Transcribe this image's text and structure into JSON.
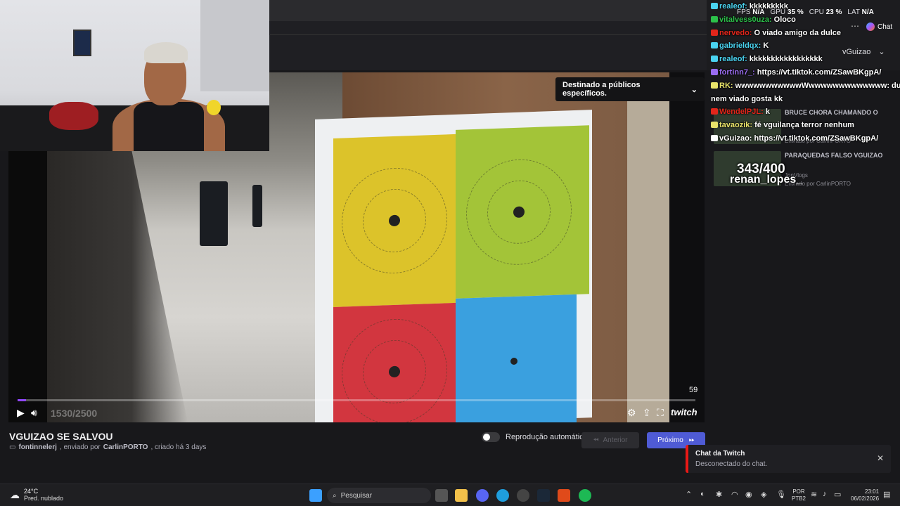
{
  "video": {
    "audience_label": "Destinado a públicos específicos.",
    "counter": "59",
    "timecode": "1530/2500",
    "brand": "twitch",
    "progress_fraction": 0.012
  },
  "clip": {
    "title": "VGUIZAO SE SALVOU",
    "author": "fontinnelerj",
    "sent_by_prefix": ", enviado por",
    "sender": "CarlinPORTO",
    "created": ", criado há 3 days"
  },
  "controls": {
    "autoplay_label": "Reprodução automática",
    "prev_label": "Anterior",
    "next_label": "Próximo"
  },
  "stats": {
    "fps_label": "FPS",
    "fps": "N/A",
    "gpu_label": "GPU",
    "gpu": "35 %",
    "cpu_label": "CPU",
    "cpu": "23 %",
    "lat_label": "LAT",
    "lat": "N/A"
  },
  "header": {
    "chat_label": "Chat",
    "channel": "vGuizao"
  },
  "sidebar_clips": [
    {
      "title": "BRUCE CHORA CHAMANDO O",
      "by": "Enviado por CarlinPORTO"
    },
    {
      "title": "PARAQUEDAS FALSO VGUIZAO",
      "by": "Enviado por CarlinPORTO",
      "channel": "JonVlogs"
    }
  ],
  "chat": [
    {
      "user": "realeof",
      "color": "#4ad3f0",
      "message": "kkkkkkkkk"
    },
    {
      "user": "vitalvess0uza",
      "color": "#2cc04a",
      "message": "Oloco"
    },
    {
      "user": "nervedo",
      "color": "#e2261b",
      "message": "O viado amigo da dulce"
    },
    {
      "user": "gabrieldqx",
      "color": "#4ad3f0",
      "message": "K"
    },
    {
      "user": "realeof",
      "color": "#4ad3f0",
      "message": "kkkkkkkkkkkkkkkkk"
    },
    {
      "user": "fortinn7_",
      "color": "#9a6cf0",
      "message": "https://vt.tiktok.com/ZSawBKgpA/"
    },
    {
      "user": "RK",
      "color": "#e8e36a",
      "message": "wwwwwwwwwwwWwwwwwwwwwwwww: duro"
    },
    {
      "user": "",
      "color": "#ffffff",
      "message": "nem viado gosta kk"
    },
    {
      "user": "WendelPJL",
      "color": "#e2261b",
      "message": "k"
    },
    {
      "user": "tavaozik",
      "color": "#e8e36a",
      "message": "fé vguilança terror nenhum"
    },
    {
      "user": "vGuizao",
      "color": "#ffffff",
      "message": "https://vt.tiktok.com/ZSawBKgpA/"
    }
  ],
  "overlay": {
    "count": "343/400",
    "name": "renan_lopes_"
  },
  "toast": {
    "title": "Chat da Twitch",
    "body": "Desconectado do chat."
  },
  "taskbar": {
    "temp": "24°C",
    "weather": "Pred. nublado",
    "search_placeholder": "Pesquisar",
    "lang_top": "POR",
    "lang_bottom": "PTB2",
    "time": "23:01",
    "date": "06/02/2026"
  }
}
